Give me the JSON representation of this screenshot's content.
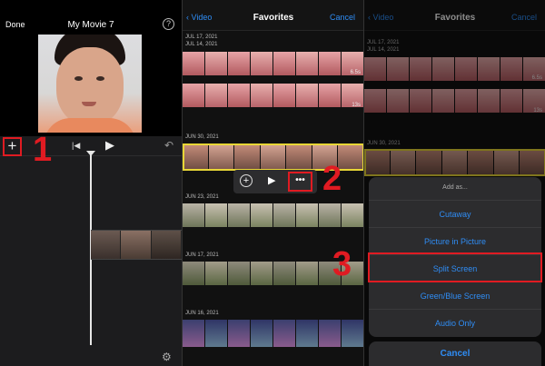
{
  "editor": {
    "done": "Done",
    "title": "My Movie 7",
    "help": "?",
    "add": "+",
    "skip_back": "|◀",
    "play": "▶",
    "undo": "↶",
    "gear": "⚙"
  },
  "steps": [
    "1",
    "2",
    "3"
  ],
  "browser": {
    "back": "Video",
    "title": "Favorites",
    "cancel": "Cancel",
    "dates": [
      "JUL 17, 2021",
      "JUL 14, 2021",
      "JUN 30, 2021",
      "JUN 23, 2021",
      "JUN 17, 2021",
      "JUN 16, 2021"
    ],
    "durations": [
      "6.5s",
      "13s"
    ],
    "toolbar": {
      "add": "+",
      "play": "▶",
      "more": "•••"
    }
  },
  "sheet": {
    "title": "Add as...",
    "options": [
      "Cutaway",
      "Picture in Picture",
      "Split Screen",
      "Green/Blue Screen",
      "Audio Only"
    ],
    "cancel": "Cancel"
  },
  "colors": {
    "accent_red": "#e01b22",
    "ios_blue": "#2f8df5",
    "selection_yellow": "#e8d636"
  }
}
